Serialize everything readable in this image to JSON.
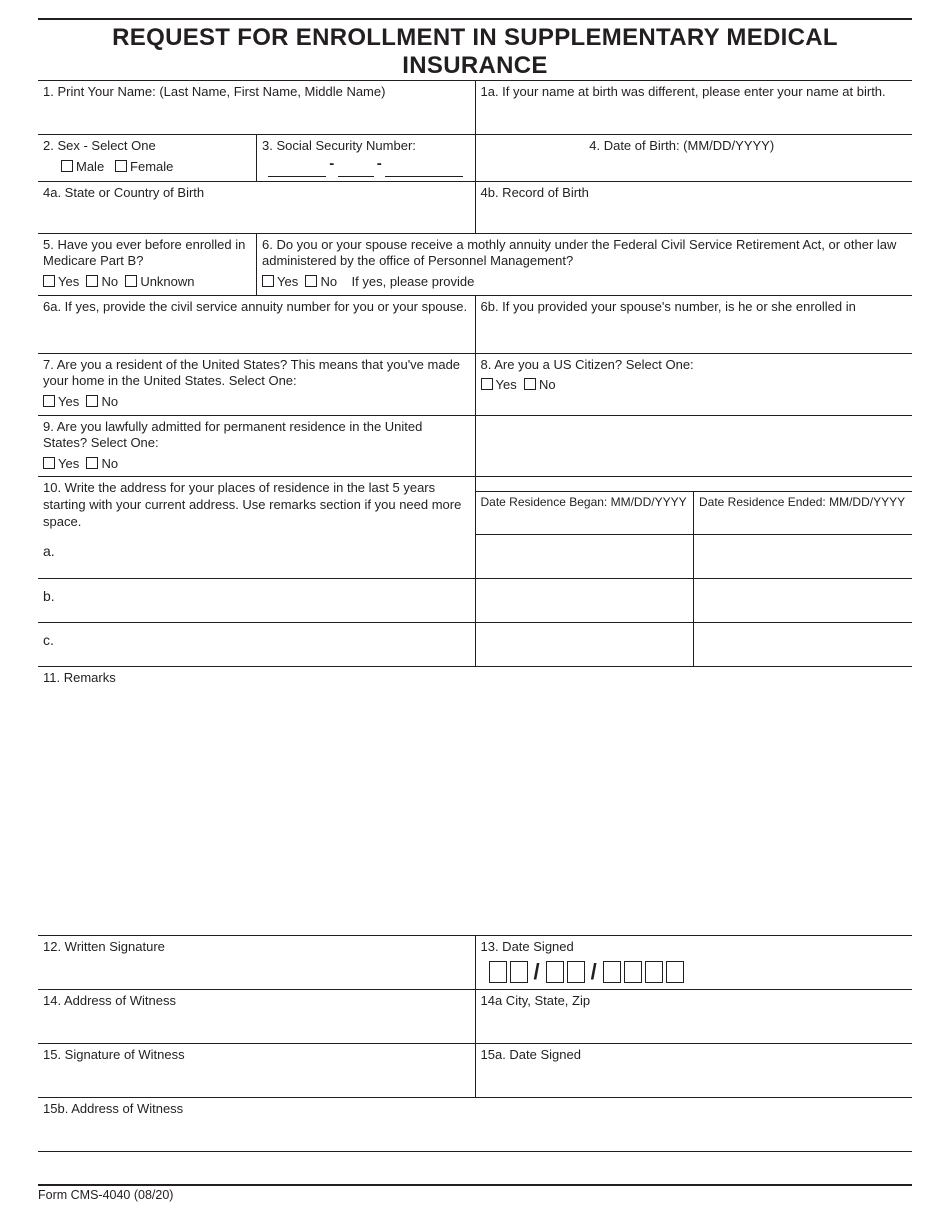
{
  "title": "REQUEST FOR ENROLLMENT IN SUPPLEMENTARY MEDICAL INSURANCE",
  "q1": "1. Print Your Name: (Last Name, First Name, Middle Name)",
  "q1a": "1a. If your name at birth was different, please enter your name at birth.",
  "q2": "2. Sex - Select One",
  "q2_male": "Male",
  "q2_female": "Female",
  "q3": "3. Social Security Number:",
  "q4": "4. Date of Birth: (MM/DD/YYYY)",
  "q4a": "4a. State or Country of Birth",
  "q4b": "4b. Record of Birth",
  "q5": "5. Have you ever before enrolled in Medicare Part B?",
  "q5_opts": {
    "yes": "Yes",
    "no": "No",
    "unknown": "Unknown"
  },
  "q6": "6. Do you or your spouse receive a mothly annuity under the Federal Civil Service Retirement Act, or other law administered by the office of Personnel Management?",
  "q6_opts": {
    "yes": "Yes",
    "no": "No",
    "suffix": "If yes, please provide"
  },
  "q6a": "6a. If yes, provide the civil service annuity number for you or your spouse.",
  "q6b": "6b. If you provided your spouse's number, is he or she enrolled in",
  "q7": "7. Are you a resident of the United States? This means that you've made your home in the United States. Select One:",
  "q7_opts": {
    "yes": "Yes",
    "no": "No"
  },
  "q8": "8. Are you a US Citizen? Select One:",
  "q8_opts": {
    "yes": "Yes",
    "no": "No"
  },
  "q9": "9. Are you lawfully admitted for permanent residence in the United States? Select One:",
  "q9_opts": {
    "yes": "Yes",
    "no": "No"
  },
  "q10": "10. Write the address for your places of residence in the last 5 years starting with your current address. Use remarks section if you need more space.",
  "q10_began": "Date Residence Began: MM/DD/YYYY",
  "q10_ended": "Date Residence Ended: MM/DD/YYYY",
  "q10_rows": {
    "a": "a.",
    "b": "b.",
    "c": "c."
  },
  "q11": "11. Remarks",
  "q12": "12. Written Signature",
  "q13": "13. Date Signed",
  "q14": "14. Address of Witness",
  "q14a": "14a City, State, Zip",
  "q15": "15. Signature of Witness",
  "q15a": "15a. Date Signed",
  "q15b": "15b. Address of Witness",
  "footer": "Form CMS-4040 (08/20)"
}
